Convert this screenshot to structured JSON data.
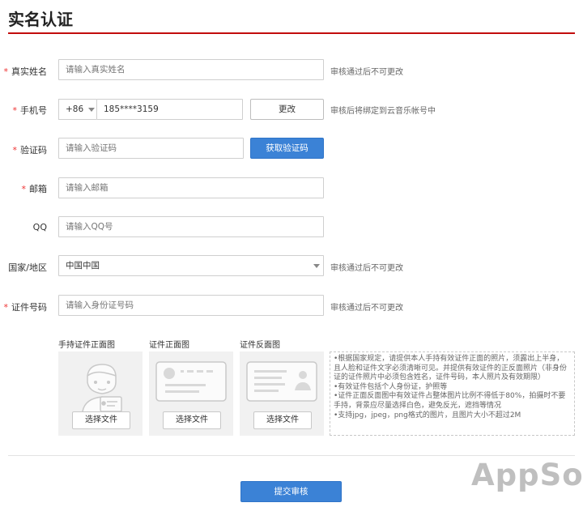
{
  "header": {
    "title": "实名认证"
  },
  "form": {
    "required_mark": "*",
    "real_name": {
      "label": "真实姓名",
      "placeholder": "请输入真实姓名",
      "hint": "审核通过后不可更改"
    },
    "phone": {
      "label": "手机号",
      "country_code": "+86",
      "value": "185****3159",
      "change_label": "更改",
      "hint": "审核后将绑定到云音乐帐号中"
    },
    "code": {
      "label": "验证码",
      "placeholder": "请输入验证码",
      "get_code_label": "获取验证码"
    },
    "email": {
      "label": "邮箱",
      "placeholder": "请输入邮箱"
    },
    "qq": {
      "label": "QQ",
      "placeholder": "请输入QQ号"
    },
    "region": {
      "label": "国家/地区",
      "value": "中国中国",
      "hint": "审核通过后不可更改"
    },
    "id_number": {
      "label": "证件号码",
      "placeholder": "请输入身份证号码",
      "hint": "审核通过后不可更改"
    }
  },
  "uploads": [
    {
      "label": "手持证件正面图",
      "button": "选择文件",
      "icon": "person-holding-id-icon"
    },
    {
      "label": "证件正面图",
      "button": "选择文件",
      "icon": "id-card-front-icon"
    },
    {
      "label": "证件反面图",
      "button": "选择文件",
      "icon": "id-card-back-icon"
    }
  ],
  "notes": [
    "•根据国家规定，请提供本人手持有效证件正面的照片，须露出上半身，且人脸和证件文字必须清晰可见。并提供有效证件的正反面照片（非身份证的证件照片中必须包含姓名，证件号码，本人照片及有效期限）",
    "•有效证件包括个人身份证，护照等",
    "•证件正面反面图中有效证件占整体图片比例不得低于80%，拍摄时不要手持，背景应尽量选择白色，避免反光，遮挡等情况",
    "•支持jpg，jpeg，png格式的图片，且图片大小不超过2M"
  ],
  "submit_label": "提交审核",
  "watermark": "AppSo",
  "colors": {
    "accent_red": "#c20c0c",
    "button_blue": "#3b82d6",
    "required_red": "#ee3333"
  }
}
